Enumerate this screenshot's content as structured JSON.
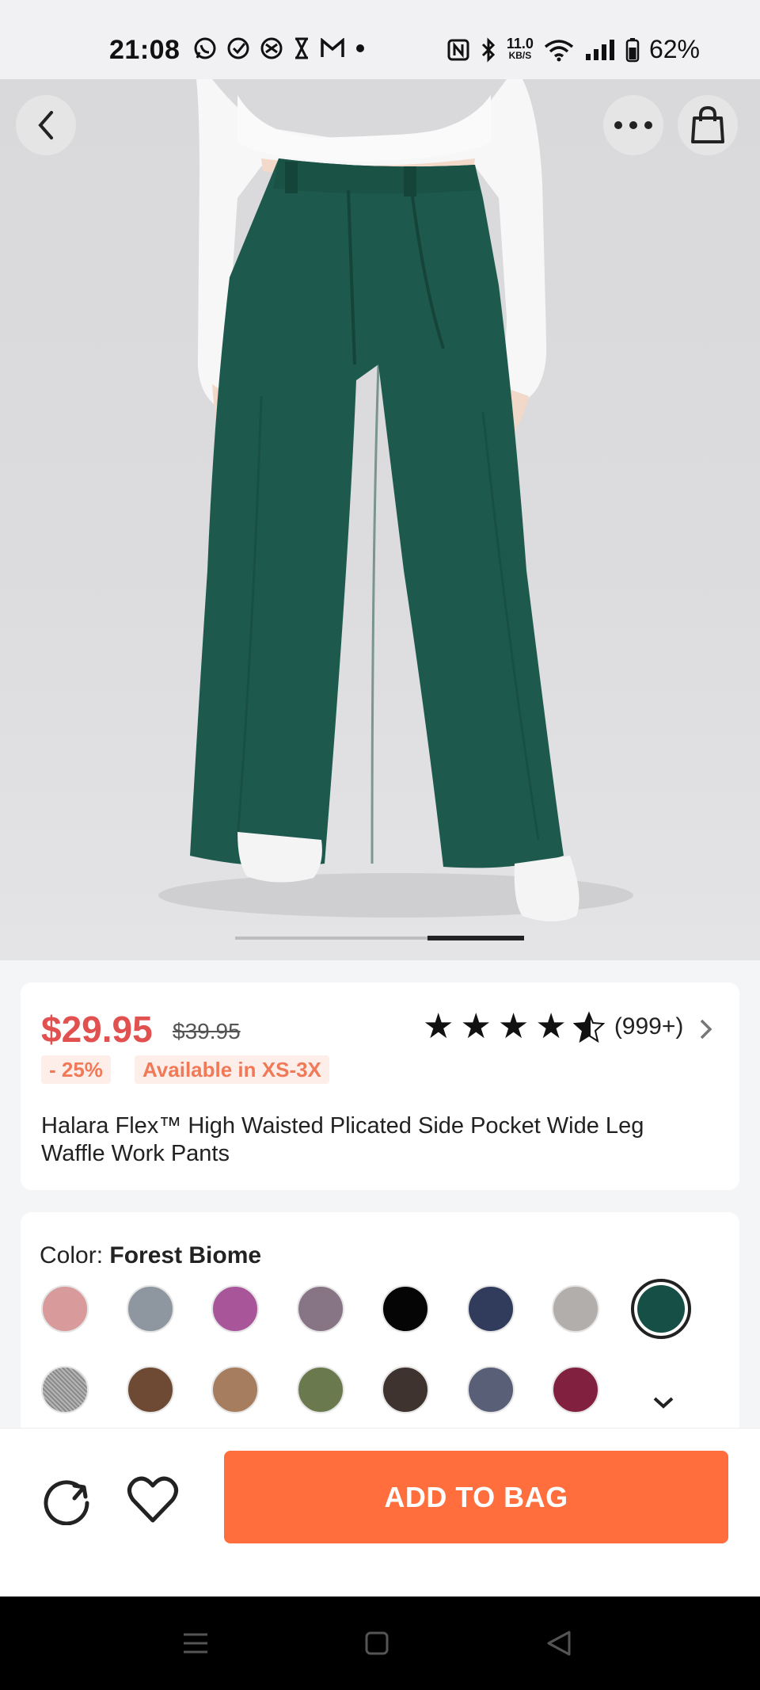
{
  "status_bar": {
    "time": "21:08",
    "net_speed_value": "11.0",
    "net_speed_unit": "KB/S",
    "battery": "62%",
    "icons": [
      "whatsapp-icon",
      "check-circle-icon",
      "signal-app-icon",
      "hourglass-icon",
      "gmail-icon",
      "dot-icon",
      "nfc-icon",
      "bluetooth-icon",
      "wifi-icon",
      "cellular-signal-icon",
      "battery-icon"
    ]
  },
  "product": {
    "price": "$29.95",
    "original_price": "$39.95",
    "discount_badge": "- 25%",
    "sizes_badge": "Available in XS-3X",
    "rating_stars": 4.5,
    "rating_count": "(999+)",
    "title": "Halara Flex™ High Waisted Plicated Side Pocket Wide Leg Waffle Work Pants",
    "image_index": 3,
    "image_count": 3
  },
  "colors": {
    "label": "Color:",
    "selected_name": "Forest Biome",
    "swatches": [
      {
        "color": "#d89a9a"
      },
      {
        "color": "#8e979f"
      },
      {
        "color": "#a95599"
      },
      {
        "color": "#877585"
      },
      {
        "color": "#050505"
      },
      {
        "color": "#313b5c"
      },
      {
        "color": "#b2aeab"
      },
      {
        "color": "#164f45",
        "selected": true
      },
      {
        "color": "#9c9c9c",
        "pattern": "heather"
      },
      {
        "color": "#6e4a34"
      },
      {
        "color": "#a77d5f"
      },
      {
        "color": "#6b7a4e"
      },
      {
        "color": "#3e332e"
      },
      {
        "color": "#585f77"
      },
      {
        "color": "#82213f"
      }
    ]
  },
  "actions": {
    "add_to_bag": "ADD TO BAG"
  },
  "theme": {
    "accent": "#ff6e3c",
    "price_color": "#e0514f",
    "pants_color": "#1d5a4d"
  }
}
